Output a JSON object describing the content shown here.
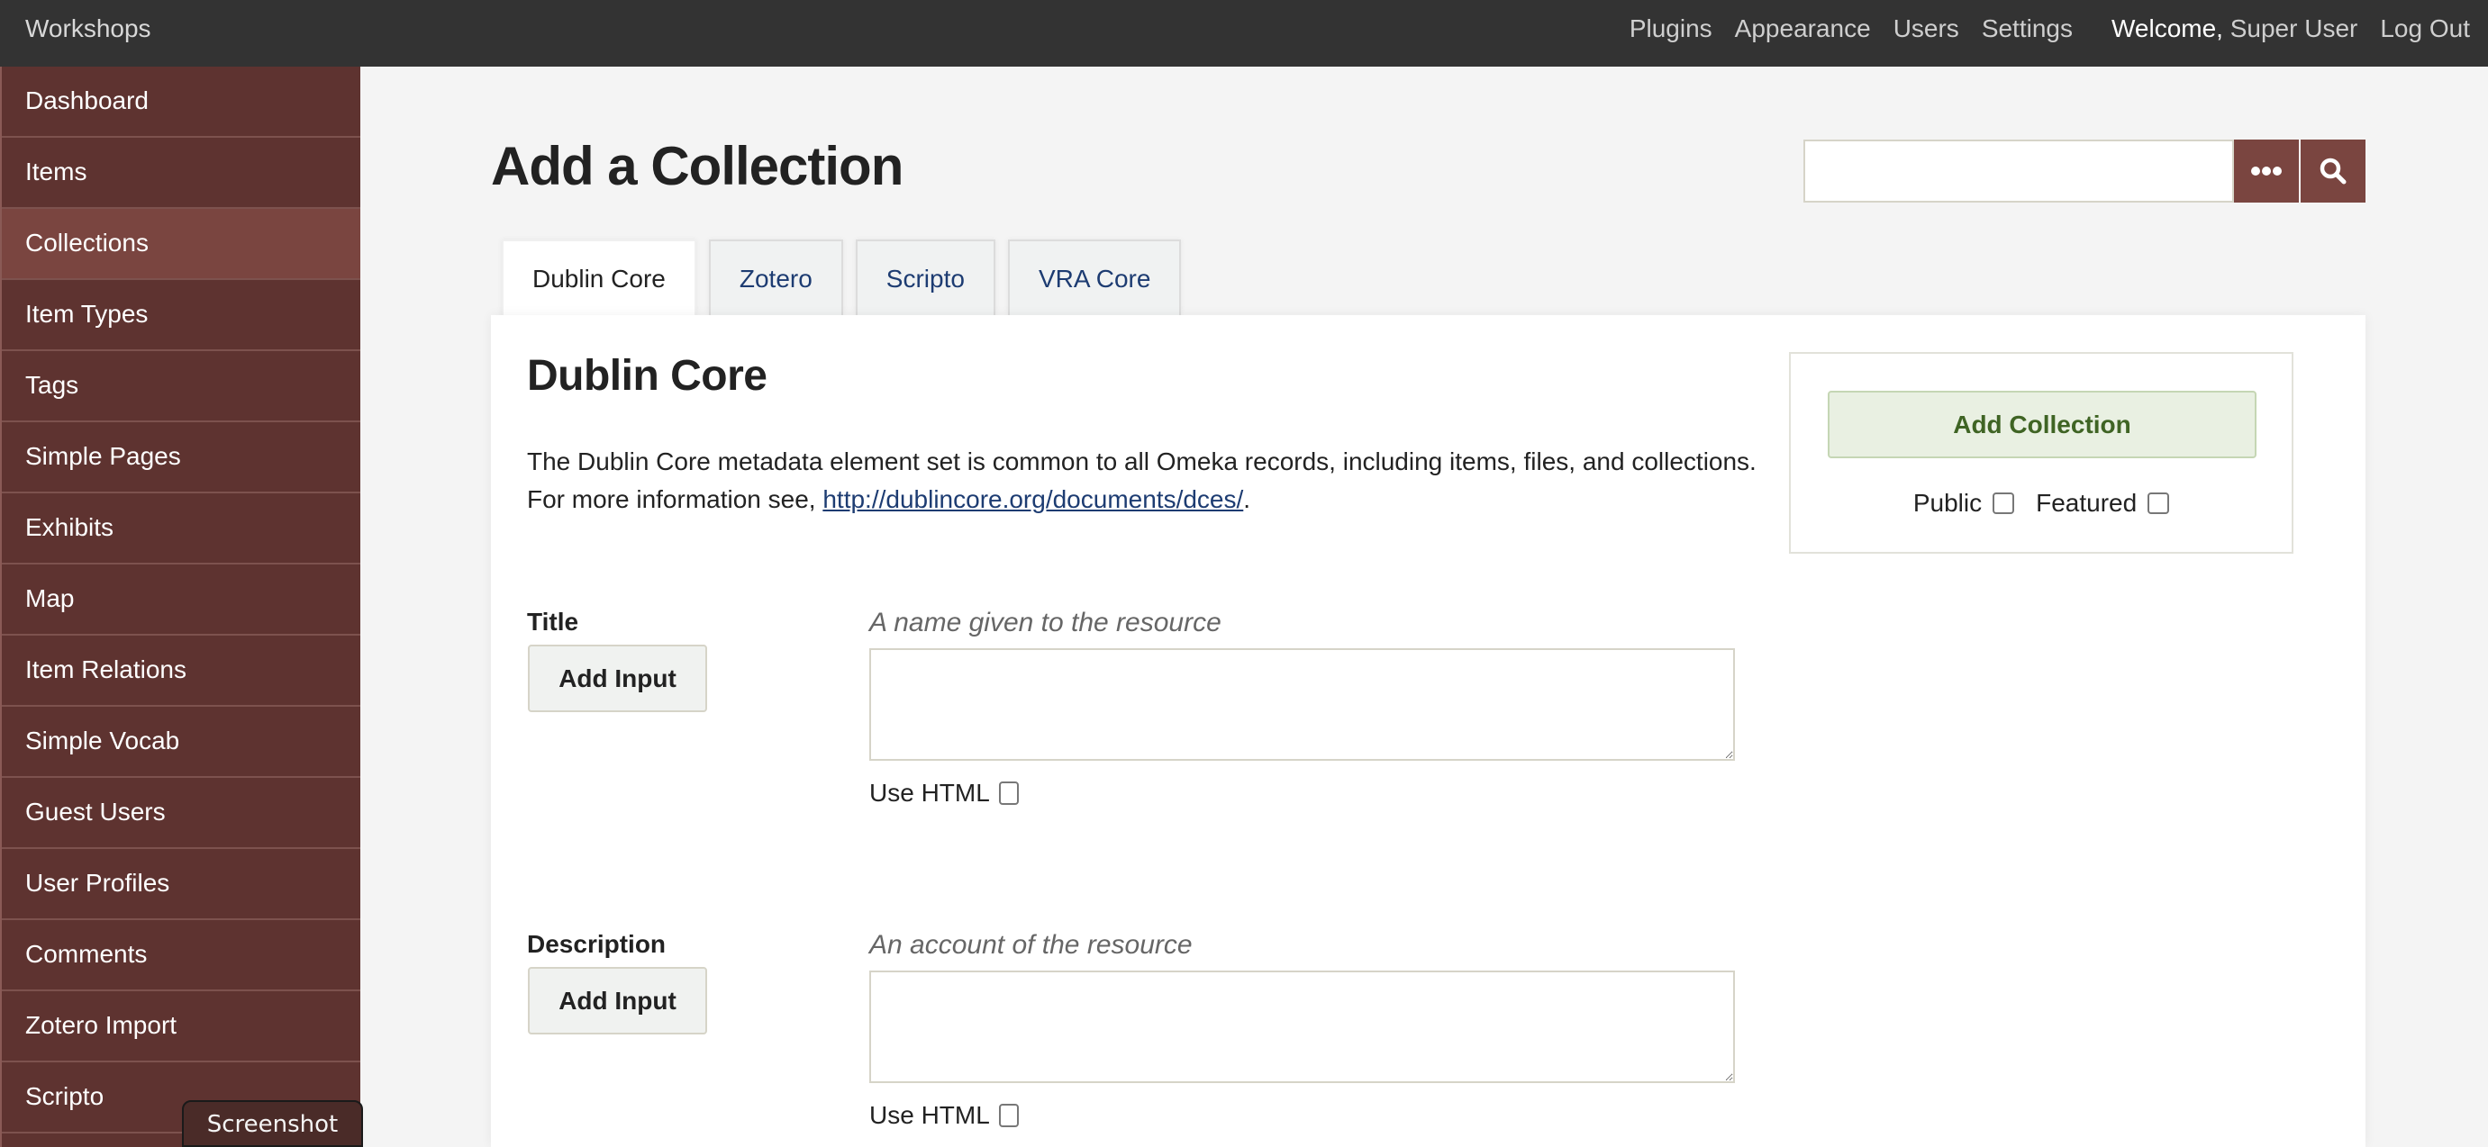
{
  "header": {
    "site_title": "Workshops",
    "nav": [
      "Plugins",
      "Appearance",
      "Users",
      "Settings"
    ],
    "welcome_label": "Welcome,",
    "user_name": "Super User",
    "logout": "Log Out"
  },
  "sidebar": {
    "active": "Collections",
    "items": [
      {
        "label": "Dashboard"
      },
      {
        "label": "Items"
      },
      {
        "label": "Collections"
      },
      {
        "label": "Item Types"
      },
      {
        "label": "Tags"
      },
      {
        "label": "Simple Pages"
      },
      {
        "label": "Exhibits"
      },
      {
        "label": "Map"
      },
      {
        "label": "Item Relations"
      },
      {
        "label": "Simple Vocab"
      },
      {
        "label": "Guest Users"
      },
      {
        "label": "User Profiles"
      },
      {
        "label": "Comments"
      },
      {
        "label": "Zotero Import"
      },
      {
        "label": "Scripto"
      }
    ]
  },
  "page": {
    "title": "Add a Collection"
  },
  "search": {
    "value": "",
    "advanced_icon": "ellipsis-icon",
    "submit_icon": "search-icon"
  },
  "tabs": [
    {
      "label": "Dublin Core",
      "active": true
    },
    {
      "label": "Zotero",
      "active": false
    },
    {
      "label": "Scripto",
      "active": false
    },
    {
      "label": "VRA Core",
      "active": false
    }
  ],
  "section": {
    "heading": "Dublin Core",
    "intro_text": "The Dublin Core metadata element set is common to all Omeka records, including items, files, and collections. For more information see, ",
    "intro_link": "http://dublincore.org/documents/dces/",
    "intro_end": "."
  },
  "save_panel": {
    "button": "Add Collection",
    "public_label": "Public",
    "public_checked": false,
    "featured_label": "Featured",
    "featured_checked": false
  },
  "fields": [
    {
      "label": "Title",
      "hint": "A name given to the resource",
      "add_input": "Add Input",
      "value": "",
      "use_html_label": "Use HTML",
      "use_html": false
    },
    {
      "label": "Description",
      "hint": "An account of the resource",
      "add_input": "Add Input",
      "value": "",
      "use_html_label": "Use HTML",
      "use_html": false
    }
  ],
  "tooltip": {
    "text": "Screenshot"
  },
  "colors": {
    "topbar": "#333333",
    "sidebar": "#5e3330",
    "sidebar_active": "#7a4540",
    "accent": "#7a4540",
    "link": "#1d3c72",
    "save_button_bg": "#e9f0e2",
    "save_button_text": "#3f6424"
  }
}
